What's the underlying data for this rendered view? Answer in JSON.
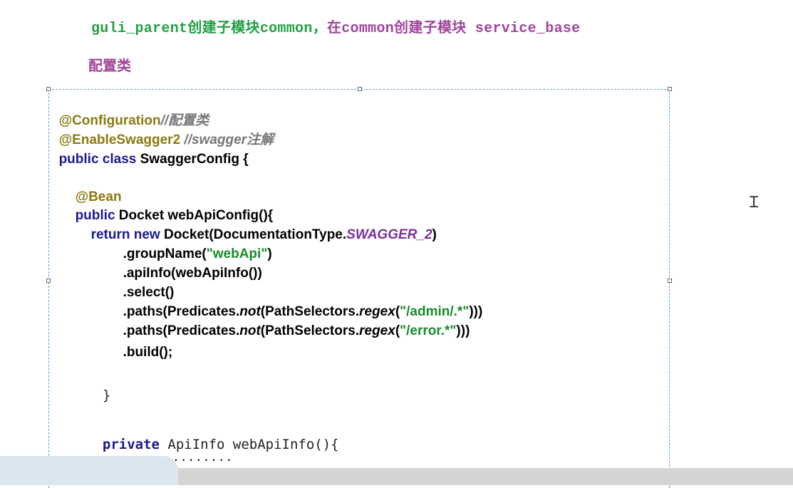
{
  "heading": {
    "part1": "guli_parent创建子模块common，",
    "part2": "在common创建子模块 service_base"
  },
  "subheading": "配置类",
  "code": {
    "line1_anno": "@Configuration",
    "line1_comment": "//配置类",
    "line2_anno": "@EnableSwagger2",
    "line2_comment": " //swagger注解",
    "line3_kw": "public class",
    "line3_rest": " SwaggerConfig {",
    "bean": "@Bean",
    "method_kw": "public",
    "method_rest": " Docket webApiConfig(){",
    "return_kw": "return new",
    "return_rest": " Docket(DocumentationType.",
    "return_const": "SWAGGER_2",
    "return_close": ")",
    "groupName_pre": ".groupName(",
    "groupName_str": "\"webApi\"",
    "groupName_post": ")",
    "apiInfo": ".apiInfo(webApiInfo())",
    "select": ".select()",
    "paths1_pre": ".paths(Predicates.",
    "paths1_not": "not",
    "paths1_mid": "(PathSelectors.",
    "paths1_regex": "regex",
    "paths1_open": "(",
    "paths1_str": "\"/admin/.*\"",
    "paths1_close": ")))",
    "paths2_pre": ".paths(Predicates.",
    "paths2_not": "not",
    "paths2_mid": "(PathSelectors.",
    "paths2_regex": "regex",
    "paths2_open": "(",
    "paths2_str": "\"/error.*\"",
    "paths2_close": ")))",
    "build": ".build();",
    "close_brace": "}",
    "private_kw": "private",
    "private_rest": " ApiInfo webApiInfo(){"
  },
  "dotted_line": "........................",
  "colors": {
    "heading_green": "#22a044",
    "heading_purple": "#a0449a",
    "annotation": "#8a7a10",
    "keyword": "#1a1a90",
    "string": "#1c8a2c"
  },
  "icons": {
    "cursor": "text-cursor-icon"
  }
}
